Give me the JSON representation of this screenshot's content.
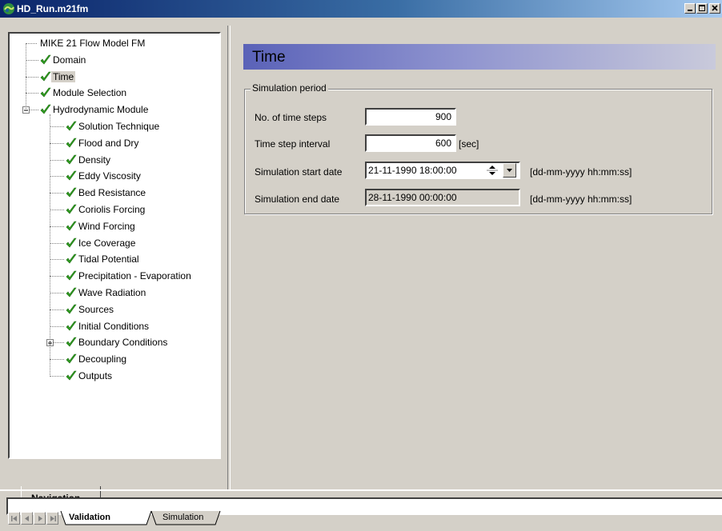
{
  "window": {
    "title": "HD_Run.m21fm",
    "accent_color": "#0a246a"
  },
  "navigation": {
    "tab_label": "Navigation",
    "tree": [
      {
        "label": "MIKE 21 Flow Model FM",
        "level": 0,
        "checked": false
      },
      {
        "label": "Domain",
        "level": 1,
        "checked": true
      },
      {
        "label": "Time",
        "level": 1,
        "checked": true,
        "selected": true
      },
      {
        "label": "Module Selection",
        "level": 1,
        "checked": true
      },
      {
        "label": "Hydrodynamic Module",
        "level": 1,
        "checked": true,
        "expanded": true
      },
      {
        "label": "Solution Technique",
        "level": 2,
        "checked": true
      },
      {
        "label": "Flood and Dry",
        "level": 2,
        "checked": true
      },
      {
        "label": "Density",
        "level": 2,
        "checked": true
      },
      {
        "label": "Eddy Viscosity",
        "level": 2,
        "checked": true
      },
      {
        "label": "Bed Resistance",
        "level": 2,
        "checked": true
      },
      {
        "label": "Coriolis Forcing",
        "level": 2,
        "checked": true
      },
      {
        "label": "Wind Forcing",
        "level": 2,
        "checked": true
      },
      {
        "label": "Ice Coverage",
        "level": 2,
        "checked": true
      },
      {
        "label": "Tidal Potential",
        "level": 2,
        "checked": true
      },
      {
        "label": "Precipitation - Evaporation",
        "level": 2,
        "checked": true
      },
      {
        "label": "Wave Radiation",
        "level": 2,
        "checked": true
      },
      {
        "label": "Sources",
        "level": 2,
        "checked": true
      },
      {
        "label": "Initial Conditions",
        "level": 2,
        "checked": true
      },
      {
        "label": "Boundary Conditions",
        "level": 2,
        "checked": true,
        "collapsed": true
      },
      {
        "label": "Decoupling",
        "level": 2,
        "checked": true
      },
      {
        "label": "Outputs",
        "level": 2,
        "checked": true
      }
    ]
  },
  "content": {
    "section_title": "Time",
    "group_title": "Simulation period",
    "fields": {
      "time_steps": {
        "label": "No. of time steps",
        "value": "900"
      },
      "time_step_interval": {
        "label": "Time step interval",
        "value": "600",
        "unit": "[sec]"
      },
      "start_date": {
        "label": "Simulation start date",
        "value": "21-11-1990 18:00:00",
        "format": "[dd-mm-yyyy hh:mm:ss]"
      },
      "end_date": {
        "label": "Simulation end date",
        "value": "28-11-1990 00:00:00",
        "format": "[dd-mm-yyyy hh:mm:ss]"
      }
    }
  },
  "bottom": {
    "tabs": [
      "Validation",
      "Simulation"
    ],
    "active_tab": "Validation"
  },
  "colors": {
    "check_green": "#2e9e1f",
    "header_gradient_start": "#5a62b8",
    "face": "#d4d0c8"
  }
}
